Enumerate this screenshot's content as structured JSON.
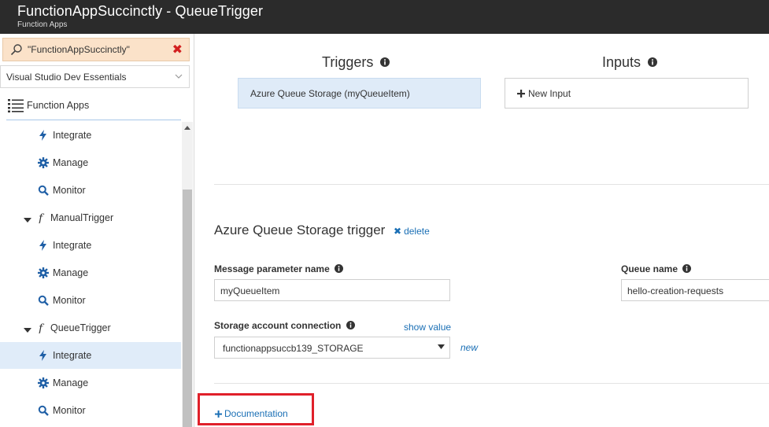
{
  "window": {
    "title": "FunctionAppSuccinctly - QueueTrigger",
    "subtitle": "Function Apps"
  },
  "sidebar": {
    "search_value": "\"FunctionAppSuccinctly\"",
    "subscription": "Visual Studio Dev Essentials",
    "function_apps_label": "Function Apps",
    "tree": [
      {
        "kind": "child",
        "icon": "bolt-icon",
        "label": "Integrate",
        "selected": false
      },
      {
        "kind": "child",
        "icon": "gear-icon",
        "label": "Manage",
        "selected": false
      },
      {
        "kind": "child",
        "icon": "search-icon",
        "label": "Monitor",
        "selected": false
      },
      {
        "kind": "function",
        "icon": "function-icon",
        "label": "ManualTrigger",
        "selected": false
      },
      {
        "kind": "child",
        "icon": "bolt-icon",
        "label": "Integrate",
        "selected": false
      },
      {
        "kind": "child",
        "icon": "gear-icon",
        "label": "Manage",
        "selected": false
      },
      {
        "kind": "child",
        "icon": "search-icon",
        "label": "Monitor",
        "selected": false
      },
      {
        "kind": "function",
        "icon": "function-icon",
        "label": "QueueTrigger",
        "selected": false
      },
      {
        "kind": "child",
        "icon": "bolt-icon",
        "label": "Integrate",
        "selected": true
      },
      {
        "kind": "child",
        "icon": "gear-icon",
        "label": "Manage",
        "selected": false
      },
      {
        "kind": "child",
        "icon": "search-icon",
        "label": "Monitor",
        "selected": false
      }
    ]
  },
  "main": {
    "triggers_header": "Triggers",
    "inputs_header": "Inputs",
    "trigger_card": "Azure Queue Storage (myQueueItem)",
    "new_input_label": "New Input",
    "trigger_section_title": "Azure Queue Storage trigger",
    "delete_label": "delete",
    "message_param_label": "Message parameter name",
    "message_param_value": "myQueueItem",
    "queue_name_label": "Queue name",
    "queue_name_value": "hello-creation-requests",
    "storage_conn_label": "Storage account connection",
    "show_value_label": "show value",
    "storage_conn_value": "functionappsuccb139_STORAGE",
    "new_label": "new",
    "documentation_label": "Documentation"
  },
  "colors": {
    "titlebar": "#2b2b2b",
    "accent_link": "#1a6fb5",
    "icon_blue": "#1f5fa6",
    "selected_row": "#e0ecf9",
    "search_bg": "#fbe2c9",
    "highlight_red": "#e0202a"
  }
}
